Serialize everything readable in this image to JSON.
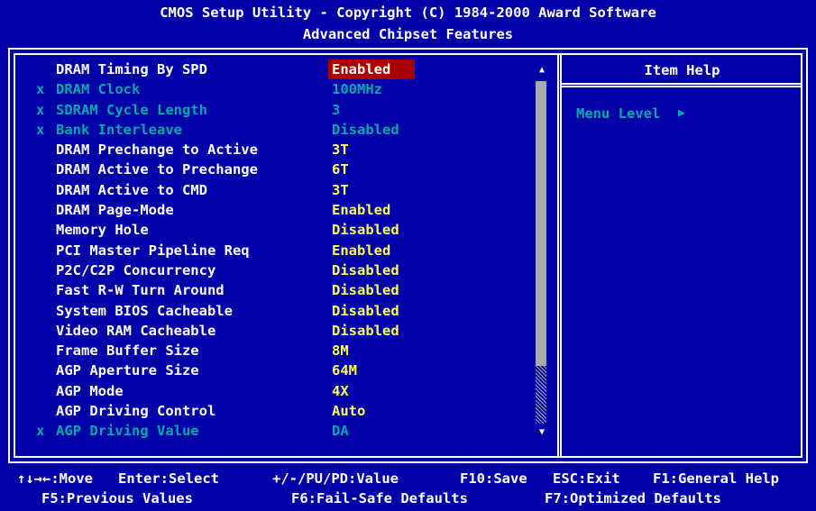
{
  "header": {
    "line1": "CMOS Setup Utility - Copyright (C) 1984-2000 Award Software",
    "line2": "Advanced Chipset Features"
  },
  "settings": [
    {
      "label": "DRAM Timing By SPD",
      "value": "Enabled",
      "mark": "",
      "disabled": false,
      "selected": true
    },
    {
      "label": "DRAM Clock",
      "value": "100MHz",
      "mark": "x",
      "disabled": true,
      "selected": false
    },
    {
      "label": "SDRAM Cycle Length",
      "value": "3",
      "mark": "x",
      "disabled": true,
      "selected": false
    },
    {
      "label": "Bank Interleave",
      "value": "Disabled",
      "mark": "x",
      "disabled": true,
      "selected": false
    },
    {
      "label": "DRAM Prechange to Active",
      "value": "3T",
      "mark": "",
      "disabled": false,
      "selected": false
    },
    {
      "label": "DRAM Active to Prechange",
      "value": "6T",
      "mark": "",
      "disabled": false,
      "selected": false
    },
    {
      "label": "DRAM Active to CMD",
      "value": "3T",
      "mark": "",
      "disabled": false,
      "selected": false
    },
    {
      "label": "DRAM Page-Mode",
      "value": "Enabled",
      "mark": "",
      "disabled": false,
      "selected": false
    },
    {
      "label": "Memory Hole",
      "value": "Disabled",
      "mark": "",
      "disabled": false,
      "selected": false
    },
    {
      "label": "PCI Master Pipeline Req",
      "value": "Enabled",
      "mark": "",
      "disabled": false,
      "selected": false
    },
    {
      "label": "P2C/C2P Concurrency",
      "value": "Disabled",
      "mark": "",
      "disabled": false,
      "selected": false
    },
    {
      "label": "Fast R-W Turn Around",
      "value": "Disabled",
      "mark": "",
      "disabled": false,
      "selected": false
    },
    {
      "label": "System BIOS Cacheable",
      "value": "Disabled",
      "mark": "",
      "disabled": false,
      "selected": false
    },
    {
      "label": "Video RAM Cacheable",
      "value": "Disabled",
      "mark": "",
      "disabled": false,
      "selected": false
    },
    {
      "label": "Frame Buffer Size",
      "value": "8M",
      "mark": "",
      "disabled": false,
      "selected": false
    },
    {
      "label": "AGP Aperture Size",
      "value": "64M",
      "mark": "",
      "disabled": false,
      "selected": false
    },
    {
      "label": "AGP Mode",
      "value": "4X",
      "mark": "",
      "disabled": false,
      "selected": false
    },
    {
      "label": "AGP Driving Control",
      "value": "Auto",
      "mark": "",
      "disabled": false,
      "selected": false
    },
    {
      "label": "AGP Driving Value",
      "value": "DA",
      "mark": "x",
      "disabled": true,
      "selected": false
    }
  ],
  "help": {
    "title": "Item Help",
    "menu_level": "Menu Level",
    "menu_arrow": "▶"
  },
  "footer": {
    "move": "↑↓→←:Move",
    "enter": "Enter:Select",
    "value": "+/-/PU/PD:Value",
    "save": "F10:Save",
    "exit": "ESC:Exit",
    "help": "F1:General Help",
    "prev": "F5:Previous Values",
    "failsafe": "F6:Fail-Safe Defaults",
    "optimized": "F7:Optimized Defaults"
  },
  "scroll": {
    "up_icon": "▲",
    "down_icon": "▼"
  },
  "colors": {
    "background": "#0000a8",
    "value": "#ffff55",
    "disabled": "#00aaaa",
    "selected_bg": "#aa0000"
  }
}
